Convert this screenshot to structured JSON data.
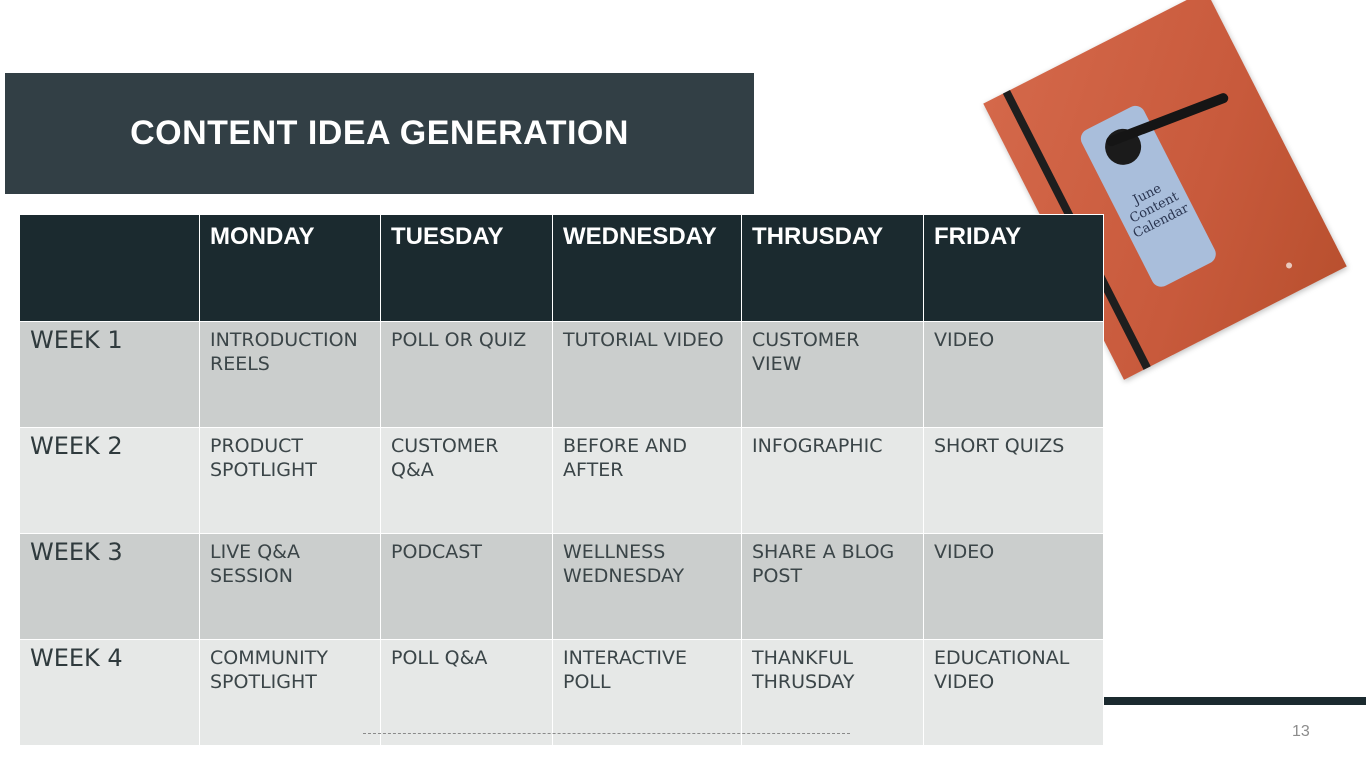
{
  "slide": {
    "title": "CONTENT IDEA GENERATION",
    "page_number": "13"
  },
  "photo": {
    "tag_text": "June Content Calendar"
  },
  "table": {
    "headers": [
      "",
      "MONDAY",
      "TUESDAY",
      "WEDNESDAY",
      "THRUSDAY",
      "FRIDAY"
    ],
    "rows": [
      {
        "week": "WEEK 1",
        "cells": [
          "INTRODUCTION REELS",
          "POLL OR QUIZ",
          "TUTORIAL VIDEO",
          "CUSTOMER VIEW",
          "VIDEO"
        ]
      },
      {
        "week": "WEEK 2",
        "cells": [
          "PRODUCT SPOTLIGHT",
          "CUSTOMER Q&A",
          "BEFORE AND AFTER",
          "INFOGRAPHIC",
          "SHORT QUIZS"
        ]
      },
      {
        "week": "WEEK 3",
        "cells": [
          "LIVE Q&A SESSION",
          "PODCAST",
          "WELLNESS WEDNESDAY",
          "SHARE A BLOG POST",
          "VIDEO"
        ]
      },
      {
        "week": "WEEK 4",
        "cells": [
          "COMMUNITY SPOTLIGHT",
          "POLL Q&A",
          "INTERACTIVE POLL",
          "THANKFUL THRUSDAY",
          "EDUCATIONAL VIDEO"
        ]
      }
    ]
  },
  "colors": {
    "title_bar": "#323f45",
    "header_row": "#1b2a2f",
    "row_dark": "#cbcecd",
    "row_light": "#e6e8e7",
    "photo_orange": "#c85a3c"
  }
}
